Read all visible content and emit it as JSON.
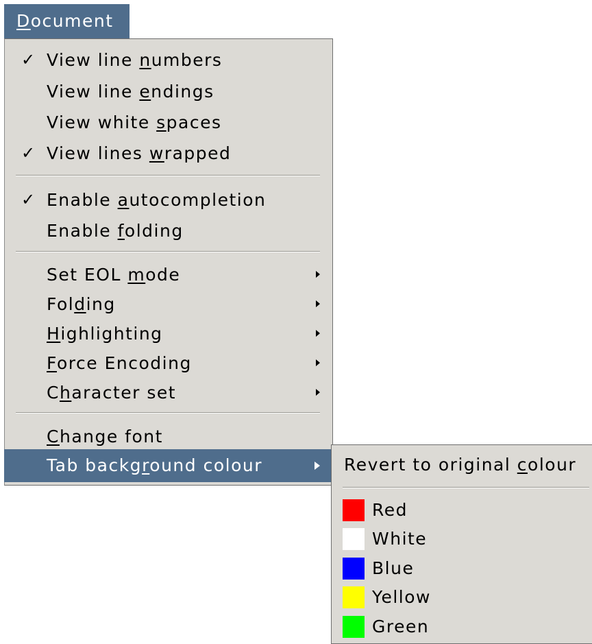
{
  "menubar": {
    "title_underlined": "D",
    "title_rest": "ocument"
  },
  "menu": {
    "items": [
      {
        "checked": true,
        "pre": "View line ",
        "u": "n",
        "post": "umbers"
      },
      {
        "checked": false,
        "pre": "View line ",
        "u": "e",
        "post": "ndings"
      },
      {
        "checked": false,
        "pre": "View white ",
        "u": "s",
        "post": "paces"
      },
      {
        "checked": true,
        "pre": "View lines ",
        "u": "w",
        "post": "rapped"
      },
      {
        "checked": true,
        "pre": "Enable ",
        "u": "a",
        "post": "utocompletion"
      },
      {
        "checked": false,
        "pre": "Enable ",
        "u": "f",
        "post": "olding"
      },
      {
        "pre": "Set EOL ",
        "u": "m",
        "post": "ode"
      },
      {
        "pre": "Fol",
        "u": "d",
        "post": "ing"
      },
      {
        "pre": "",
        "u": "H",
        "post": "ighlighting"
      },
      {
        "pre": "",
        "u": "F",
        "post": "orce Encoding"
      },
      {
        "pre": "C",
        "u": "h",
        "post": "aracter set"
      },
      {
        "pre": "",
        "u": "C",
        "post": "hange font"
      },
      {
        "pre": "Tab backg",
        "u": "r",
        "post": "ound colour"
      }
    ],
    "check_glyph": "✓"
  },
  "submenu": {
    "revert": {
      "pre": "Revert to original ",
      "u": "c",
      "post": "olour"
    },
    "colors": [
      {
        "label": "Red",
        "swatch": "#ff0000"
      },
      {
        "label": "White",
        "swatch": "#ffffff"
      },
      {
        "label": "Blue",
        "swatch": "#0000ff"
      },
      {
        "label": "Yellow",
        "swatch": "#ffff00"
      },
      {
        "label": "Green",
        "swatch": "#00ff00"
      }
    ]
  },
  "colors": {
    "menu_bg": "#dcdad5",
    "highlight": "#4f6d8c"
  }
}
